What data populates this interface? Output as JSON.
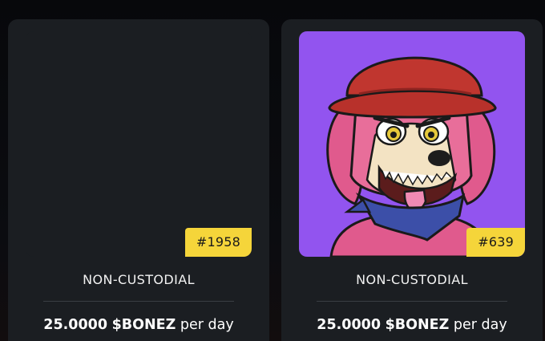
{
  "cards": [
    {
      "token_id": "#1958",
      "custody": "NON-CUSTODIAL",
      "reward_amount": "25.0000",
      "reward_token": "$BONEZ",
      "reward_period": "per day",
      "art": {
        "background": "#1b1e22"
      }
    },
    {
      "token_id": "#639",
      "custody": "NON-CUSTODIAL",
      "reward_amount": "25.0000",
      "reward_token": "$BONEZ",
      "reward_period": "per day",
      "art": {
        "background": "#9254ef",
        "subject": "pink-dog-with-red-bucket-hat-and-blue-bandana"
      }
    }
  ],
  "colors": {
    "card": "#1b1e22",
    "badge": "#f5d53a",
    "accent_purple": "#9254ef"
  }
}
